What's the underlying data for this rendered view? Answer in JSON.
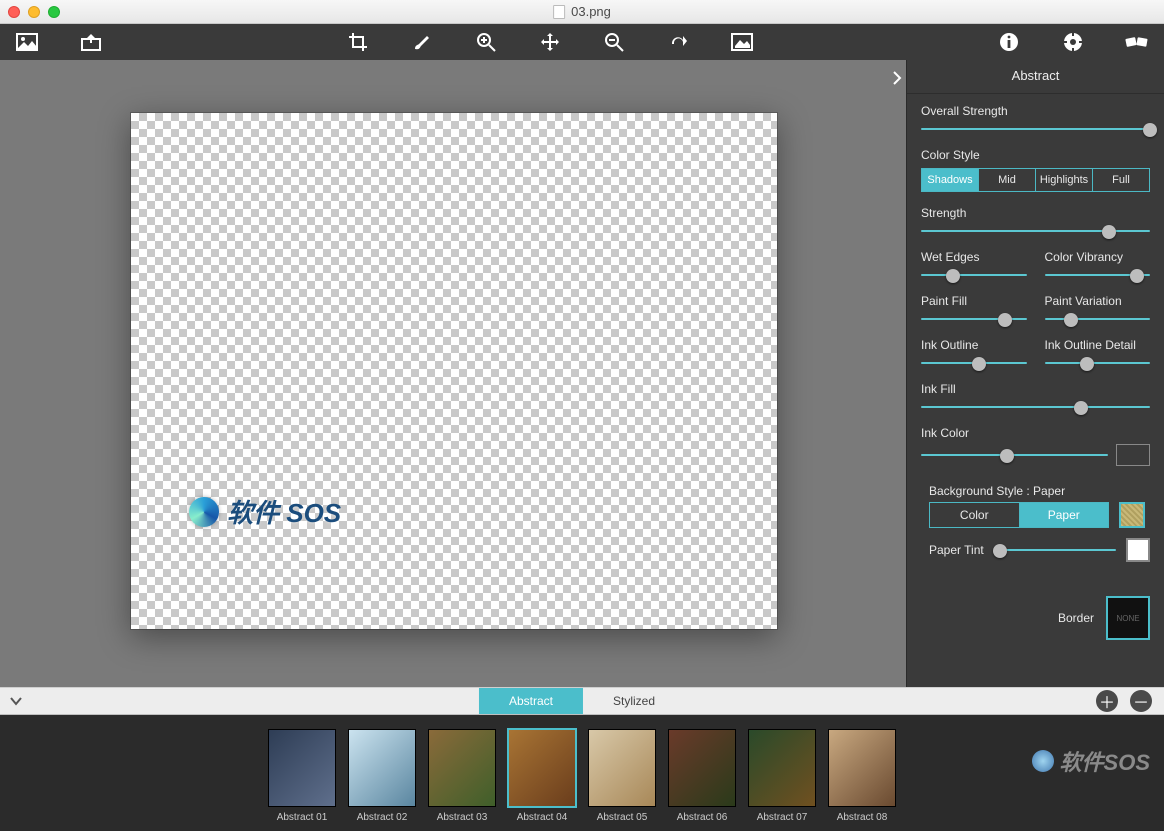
{
  "window": {
    "filename": "03.png"
  },
  "toolbar": {
    "left": [
      "open-image",
      "export-image"
    ],
    "center": [
      "crop",
      "brush",
      "zoom-in",
      "pan",
      "zoom-out",
      "redo",
      "fit-image"
    ],
    "right": [
      "info",
      "settings",
      "effects"
    ]
  },
  "panel": {
    "title": "Abstract",
    "overall_strength": {
      "label": "Overall Strength",
      "value": 100
    },
    "color_style": {
      "label": "Color Style",
      "options": [
        "Shadows",
        "Mid",
        "Highlights",
        "Full"
      ],
      "selected": "Shadows"
    },
    "strength": {
      "label": "Strength",
      "value": 82
    },
    "wet_edges": {
      "label": "Wet Edges",
      "value": 30
    },
    "color_vibrancy": {
      "label": "Color Vibrancy",
      "value": 88
    },
    "paint_fill": {
      "label": "Paint Fill",
      "value": 80
    },
    "paint_variation": {
      "label": "Paint Variation",
      "value": 25
    },
    "ink_outline": {
      "label": "Ink Outline",
      "value": 55
    },
    "ink_outline_detail": {
      "label": "Ink Outline Detail",
      "value": 40
    },
    "ink_fill": {
      "label": "Ink Fill",
      "value": 70
    },
    "ink_color": {
      "label": "Ink Color",
      "value": 46,
      "swatch": "#4a2f0c"
    },
    "background_style": {
      "label": "Background Style : Paper",
      "options": [
        "Color",
        "Paper"
      ],
      "selected": "Paper"
    },
    "paper_tint": {
      "label": "Paper Tint",
      "value": 5,
      "swatch": "#ffffff"
    },
    "border": {
      "label": "Border",
      "value": "NONE"
    }
  },
  "tabs": {
    "items": [
      "Abstract",
      "Stylized"
    ],
    "selected": "Abstract"
  },
  "presets": {
    "selected_index": 3,
    "items": [
      {
        "label": "Abstract 01",
        "colors": [
          "#2e3d55",
          "#5f6f8c"
        ]
      },
      {
        "label": "Abstract 02",
        "colors": [
          "#cbe3ef",
          "#5a86a0"
        ]
      },
      {
        "label": "Abstract 03",
        "colors": [
          "#8a6a3a",
          "#3f5f2a"
        ]
      },
      {
        "label": "Abstract 04",
        "colors": [
          "#a87434",
          "#6a3d1c"
        ]
      },
      {
        "label": "Abstract 05",
        "colors": [
          "#d8c8a8",
          "#a88858"
        ]
      },
      {
        "label": "Abstract 06",
        "colors": [
          "#6a3a2a",
          "#2a3a1a"
        ]
      },
      {
        "label": "Abstract 07",
        "colors": [
          "#2a4a2a",
          "#705020"
        ]
      },
      {
        "label": "Abstract 08",
        "colors": [
          "#c8a880",
          "#6a4a30"
        ]
      }
    ]
  },
  "watermark": {
    "text": "软件 SOS"
  },
  "corner_brand": {
    "text": "软件SOS"
  }
}
